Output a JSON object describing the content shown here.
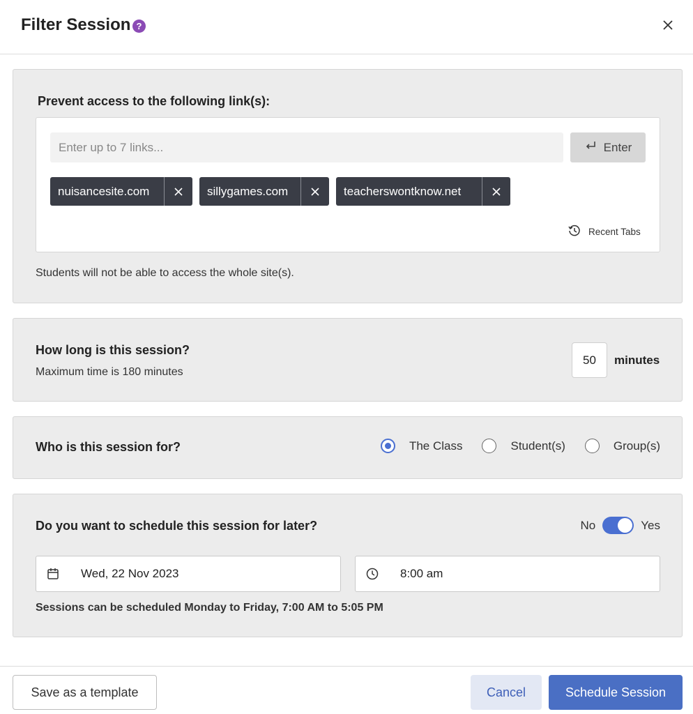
{
  "header": {
    "title": "Filter Session",
    "help_glyph": "?"
  },
  "links": {
    "heading": "Prevent access to the following link(s):",
    "input_placeholder": "Enter up to 7 links...",
    "enter_label": "Enter",
    "chips": [
      "nuisancesite.com",
      "sillygames.com",
      "teacherswontknow.net"
    ],
    "recent_tabs_label": "Recent Tabs",
    "note": "Students will not be able to access the whole site(s)."
  },
  "duration": {
    "question": "How long is this session?",
    "subtext": "Maximum time is 180 minutes",
    "value": "50",
    "unit": "minutes"
  },
  "audience": {
    "question": "Who is this session for?",
    "options": [
      "The Class",
      "Student(s)",
      "Group(s)"
    ],
    "selected": "The Class"
  },
  "schedule": {
    "question": "Do you want to schedule this session for later?",
    "toggle_off_label": "No",
    "toggle_on_label": "Yes",
    "toggle_state": "Yes",
    "date_value": "Wed, 22 Nov 2023",
    "time_value": "8:00 am",
    "note": "Sessions can be scheduled Monday to Friday, 7:00 AM to 5:05 PM"
  },
  "footer": {
    "template_label": "Save as a template",
    "cancel_label": "Cancel",
    "schedule_label": "Schedule Session"
  },
  "colors": {
    "accent": "#4a6fc4",
    "help_icon": "#8b4bb5",
    "chip_bg": "#3a3d46",
    "card_bg": "#ececec"
  }
}
